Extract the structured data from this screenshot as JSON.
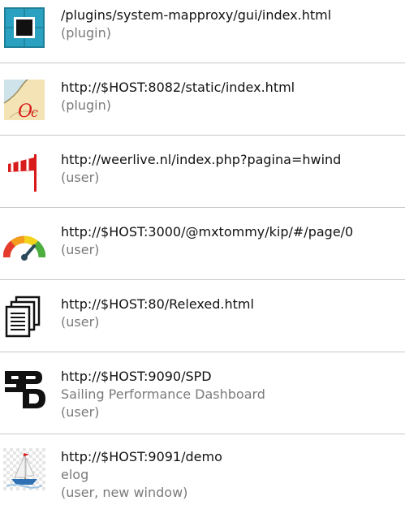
{
  "items": [
    {
      "icon": "mapproxy-icon",
      "url": "/plugins/system-mapproxy/gui/index.html",
      "desc": "",
      "type": "(plugin)"
    },
    {
      "icon": "opencpn-chart-icon",
      "url": "http://$HOST:8082/static/index.html",
      "desc": "",
      "type": "(plugin)"
    },
    {
      "icon": "windsock-icon",
      "url": "http://weerlive.nl/index.php?pagina=hwind",
      "desc": "",
      "type": "(user)"
    },
    {
      "icon": "gauge-icon",
      "url": "http://$HOST:3000/@mxtommy/kip/#/page/0",
      "desc": "",
      "type": "(user)"
    },
    {
      "icon": "documents-icon",
      "url": "http://$HOST:80/Relexed.html",
      "desc": "",
      "type": "(user)"
    },
    {
      "icon": "spd-logo-icon",
      "url": "http://$HOST:9090/SPD",
      "desc": "Sailing Performance Dashboard",
      "type": "(user)"
    },
    {
      "icon": "sailboat-icon",
      "url": "http://$HOST:9091/demo",
      "desc": "elog",
      "type": "(user, new window)"
    }
  ]
}
